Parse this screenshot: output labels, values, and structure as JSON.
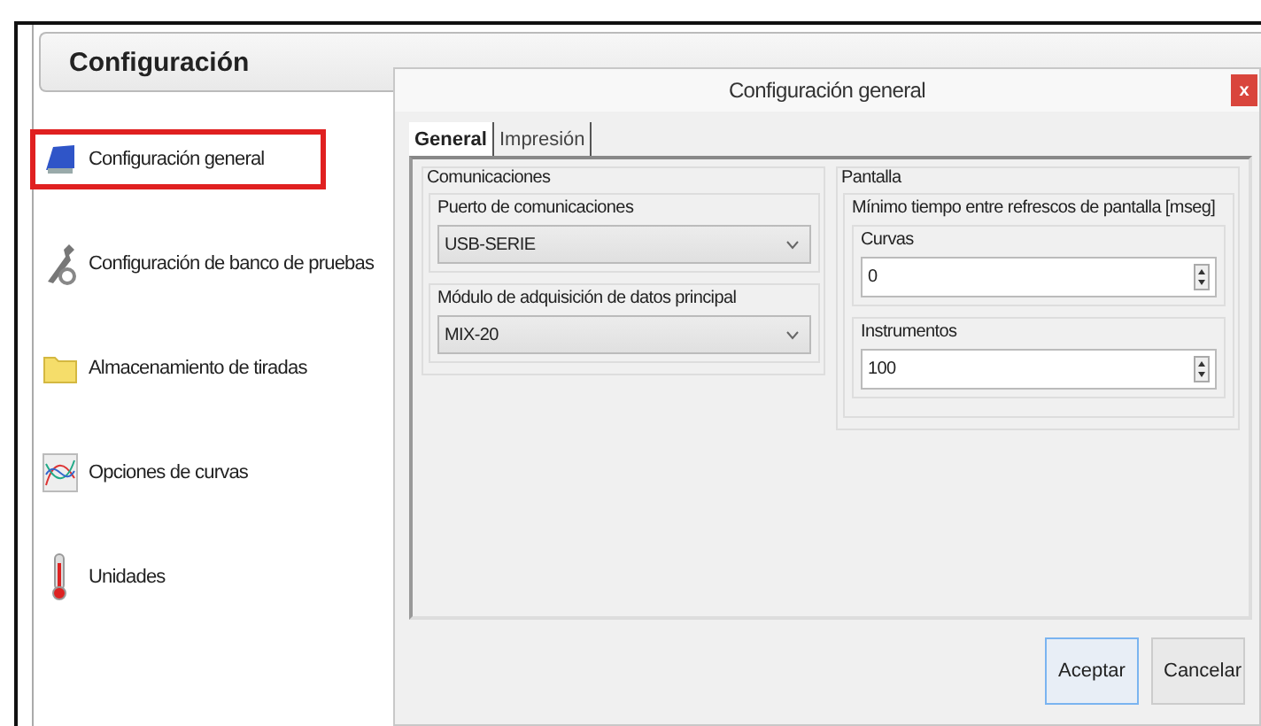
{
  "main": {
    "title": "Configuración",
    "items": [
      {
        "label": "Configuración general",
        "kind": "monitor",
        "selected": true
      },
      {
        "label": "Configuración de banco de pruebas",
        "kind": "wrench",
        "selected": false
      },
      {
        "label": "Almacenamiento de tiradas",
        "kind": "folder",
        "selected": false
      },
      {
        "label": "Opciones de curvas",
        "kind": "chart",
        "selected": false
      },
      {
        "label": "Unidades",
        "kind": "thermometer",
        "selected": false
      }
    ]
  },
  "dialog": {
    "title": "Configuración general",
    "close": "x",
    "tabs": [
      {
        "label": "General",
        "selected": true
      },
      {
        "label": "Impresión",
        "selected": false
      }
    ],
    "communications": {
      "title": "Comunicaciones",
      "fields": [
        {
          "label": "Puerto de comunicaciones",
          "value": "USB-SERIE"
        },
        {
          "label": "Módulo de adquisición de datos principal",
          "value": "MIX-20"
        }
      ]
    },
    "screen": {
      "title": "Pantalla",
      "subtitle": "Mínimo tiempo entre refrescos de pantalla [mseg]",
      "fields": [
        {
          "label": "Curvas",
          "value": "0"
        },
        {
          "label": "Instrumentos",
          "value": "100"
        }
      ]
    },
    "buttons": [
      {
        "label": "Aceptar",
        "selected": true
      },
      {
        "label": "Cancelar",
        "selected": false
      }
    ]
  }
}
